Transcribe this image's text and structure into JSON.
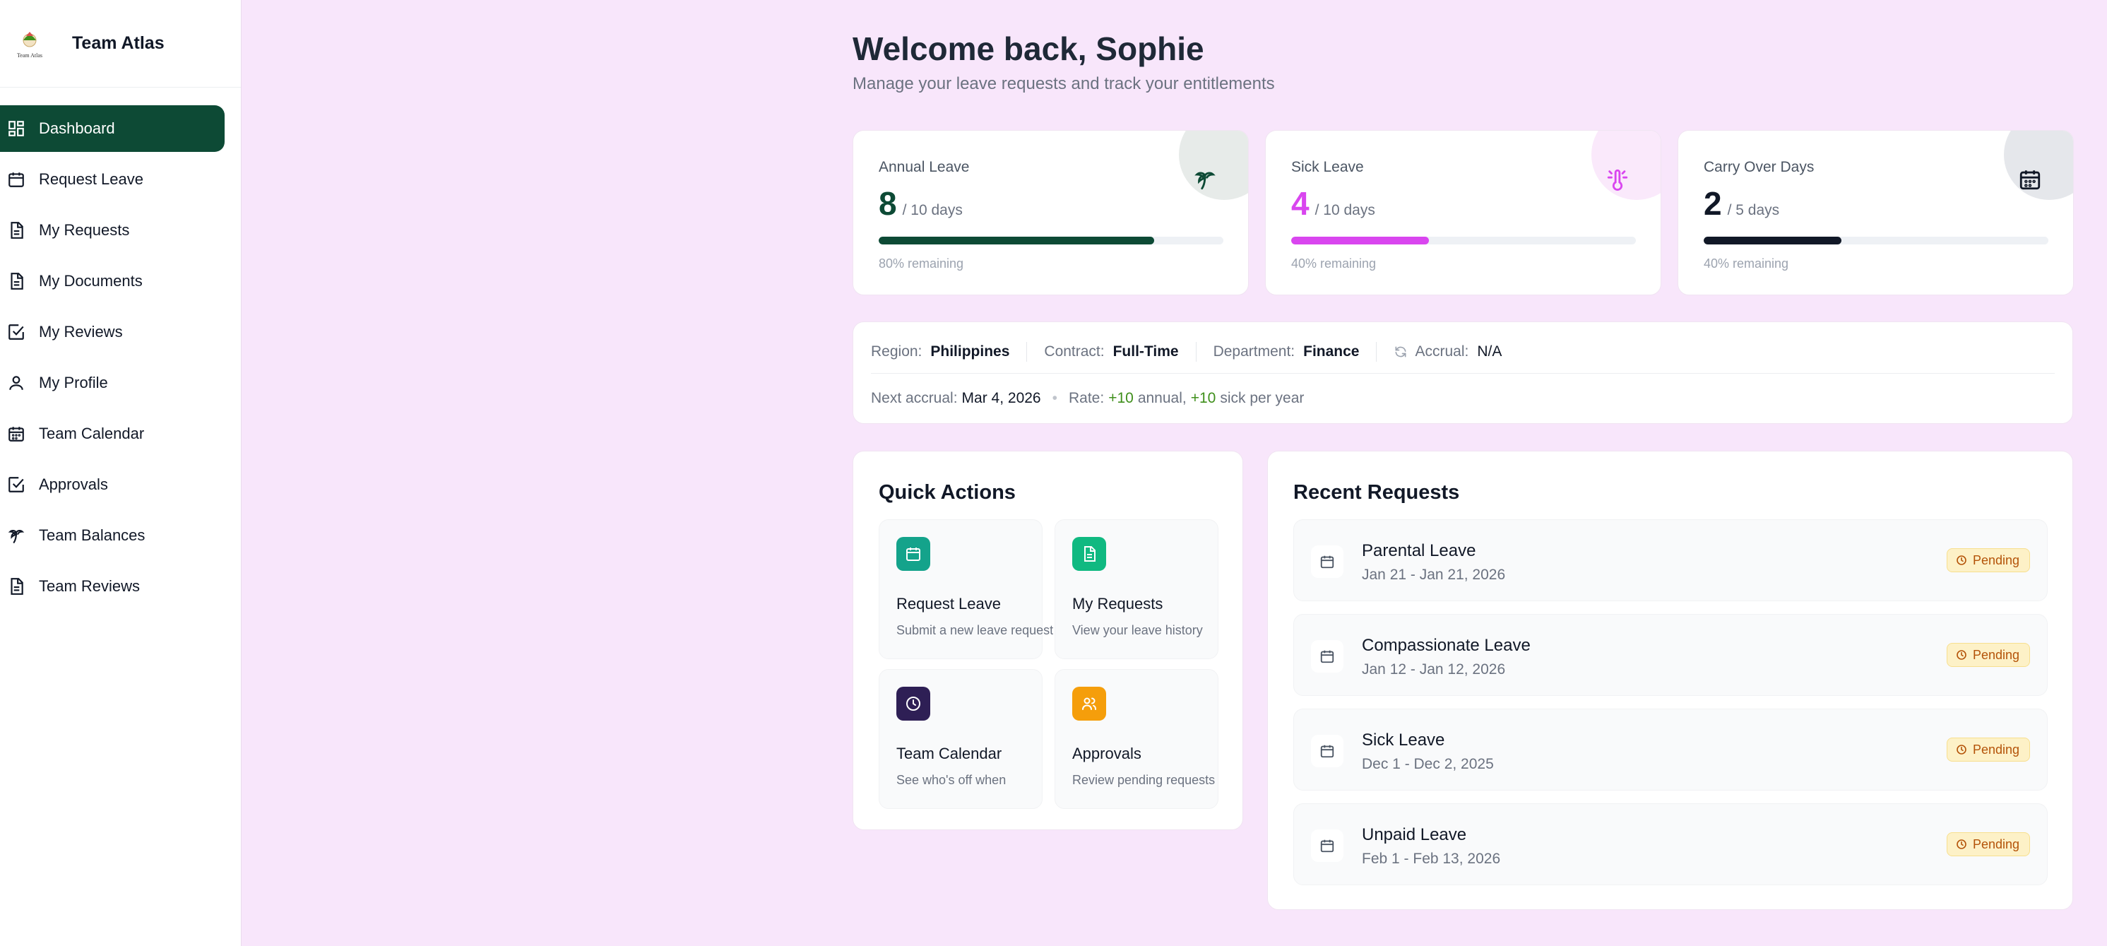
{
  "app": {
    "name": "Team Atlas",
    "logo_text": "Team Atlas"
  },
  "sidebar": {
    "items": [
      {
        "label": "Dashboard",
        "icon": "dashboard-icon",
        "active": true
      },
      {
        "label": "Request Leave",
        "icon": "calendar-icon"
      },
      {
        "label": "My Requests",
        "icon": "document-icon"
      },
      {
        "label": "My Documents",
        "icon": "document-icon"
      },
      {
        "label": "My Reviews",
        "icon": "check-square-icon"
      },
      {
        "label": "My Profile",
        "icon": "user-icon"
      },
      {
        "label": "Team Calendar",
        "icon": "calendar-grid-icon"
      },
      {
        "label": "Approvals",
        "icon": "check-square-icon"
      },
      {
        "label": "Team Balances",
        "icon": "palm-tree-icon"
      },
      {
        "label": "Team Reviews",
        "icon": "document-icon"
      }
    ]
  },
  "header": {
    "title": "Welcome back, Sophie",
    "subtitle": "Manage your leave requests and track your entitlements"
  },
  "stats": [
    {
      "title": "Annual Leave",
      "value": "8",
      "of": "/ 10 days",
      "remaining": "80% remaining",
      "fraction": 0.8,
      "color": "#0d4a35",
      "icon": "palm-tree-icon"
    },
    {
      "title": "Sick Leave",
      "value": "4",
      "of": "/ 10 days",
      "remaining": "40% remaining",
      "fraction": 0.4,
      "color": "#d946ef",
      "icon": "thermometer-icon"
    },
    {
      "title": "Carry Over Days",
      "value": "2",
      "of": "/ 5 days",
      "remaining": "40% remaining",
      "fraction": 0.4,
      "color": "#111827",
      "icon": "calendar-icon"
    }
  ],
  "info": {
    "region_label": "Region:",
    "region": "Philippines",
    "contract_label": "Contract:",
    "contract": "Full-Time",
    "department_label": "Department:",
    "department": "Finance",
    "accrual_label": "Accrual:",
    "accrual": "N/A",
    "next_accrual_label": "Next accrual:",
    "next_accrual": "Mar 4, 2026",
    "rate_label": "Rate:",
    "rate_annual": "+10",
    "annual_word": "annual,",
    "rate_sick": "+10",
    "sick_word": "sick per year"
  },
  "quick_actions": {
    "title": "Quick Actions",
    "items": [
      {
        "title": "Request Leave",
        "desc": "Submit a new leave request",
        "color": "#14a38b",
        "icon": "calendar-icon"
      },
      {
        "title": "My Requests",
        "desc": "View your leave history",
        "color": "#10b981",
        "icon": "document-icon"
      },
      {
        "title": "Team Calendar",
        "desc": "See who's off when",
        "color": "#2e1f55",
        "icon": "clock-icon"
      },
      {
        "title": "Approvals",
        "desc": "Review pending requests",
        "color": "#f59e0b",
        "icon": "users-icon"
      }
    ]
  },
  "recent_requests": {
    "title": "Recent Requests",
    "items": [
      {
        "type": "Parental Leave",
        "dates": "Jan 21 - Jan 21, 2026",
        "status": "Pending"
      },
      {
        "type": "Compassionate Leave",
        "dates": "Jan 12 - Jan 12, 2026",
        "status": "Pending"
      },
      {
        "type": "Sick Leave",
        "dates": "Dec 1 - Dec 2, 2025",
        "status": "Pending"
      },
      {
        "type": "Unpaid Leave",
        "dates": "Feb 1 - Feb 13, 2026",
        "status": "Pending"
      }
    ]
  }
}
